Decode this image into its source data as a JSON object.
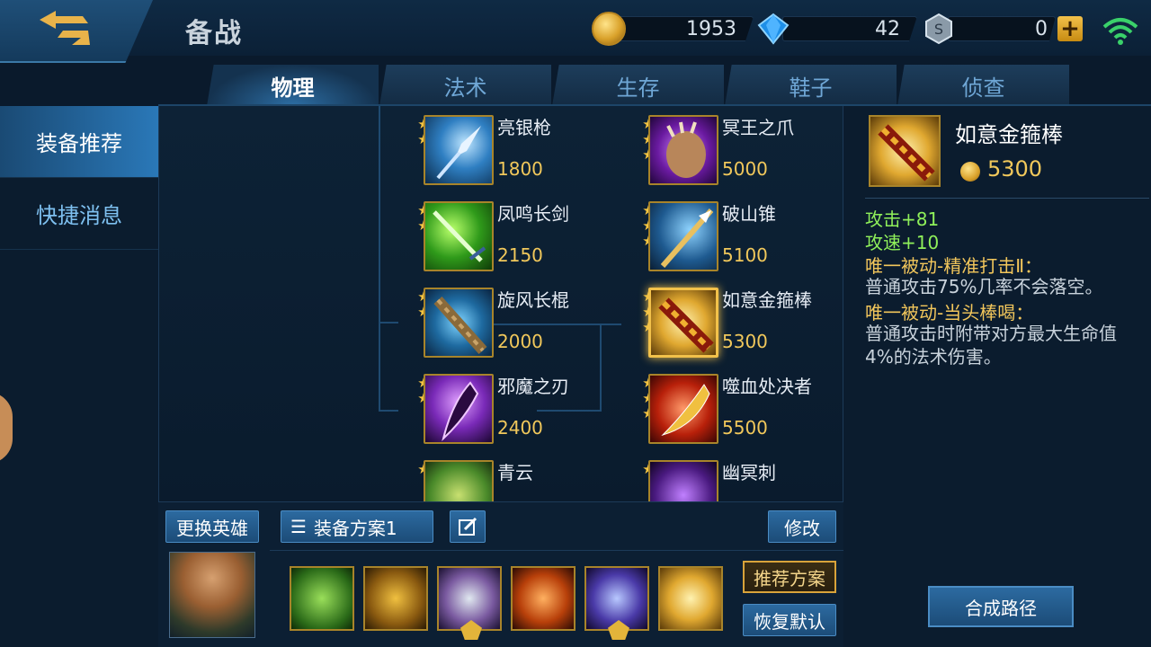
{
  "header": {
    "title": "备战",
    "gold": "1953",
    "diamonds": "42",
    "vouchers": "0",
    "plus": "+"
  },
  "tabs": [
    {
      "label": "物理",
      "active": true
    },
    {
      "label": "法术",
      "active": false
    },
    {
      "label": "生存",
      "active": false
    },
    {
      "label": "鞋子",
      "active": false
    },
    {
      "label": "侦查",
      "active": false
    }
  ],
  "sidebar": {
    "items": [
      {
        "label": "装备推荐",
        "active": true
      },
      {
        "label": "快捷消息",
        "active": false
      }
    ]
  },
  "items_left": [
    {
      "name": "亮银枪",
      "price": "1800",
      "stars": 2
    },
    {
      "name": "凤鸣长剑",
      "price": "2150",
      "stars": 2
    },
    {
      "name": "旋风长棍",
      "price": "2000",
      "stars": 2
    },
    {
      "name": "邪魔之刃",
      "price": "2400",
      "stars": 2
    },
    {
      "name": "青云",
      "price": "",
      "stars": 1
    }
  ],
  "items_right": [
    {
      "name": "冥王之爪",
      "price": "5000",
      "stars": 3
    },
    {
      "name": "破山锥",
      "price": "5100",
      "stars": 3
    },
    {
      "name": "如意金箍棒",
      "price": "5300",
      "stars": 3
    },
    {
      "name": "噬血处决者",
      "price": "5500",
      "stars": 3
    },
    {
      "name": "幽冥刺",
      "price": "",
      "stars": 1
    }
  ],
  "bottom": {
    "change_hero": "更换英雄",
    "plan_label": "装备方案1",
    "modify": "修改",
    "recommend": "推荐方案",
    "restore": "恢复默认"
  },
  "detail": {
    "name": "如意金箍棒",
    "price": "5300",
    "stat1": "攻击+81",
    "stat2": "攻速+10",
    "passive1_title": "唯一被动-精准打击Ⅱ：",
    "passive1_desc": "普通攻击75%几率不会落空。",
    "passive2_title": "唯一被动-当头棒喝：",
    "passive2_desc": "普通攻击时附带对方最大生命值4%的法术伤害。",
    "compose": "合成路径"
  },
  "colors": {
    "accent_blue": "#2a78b8",
    "gold": "#f1c85b",
    "stat_green": "#8ff05a"
  }
}
